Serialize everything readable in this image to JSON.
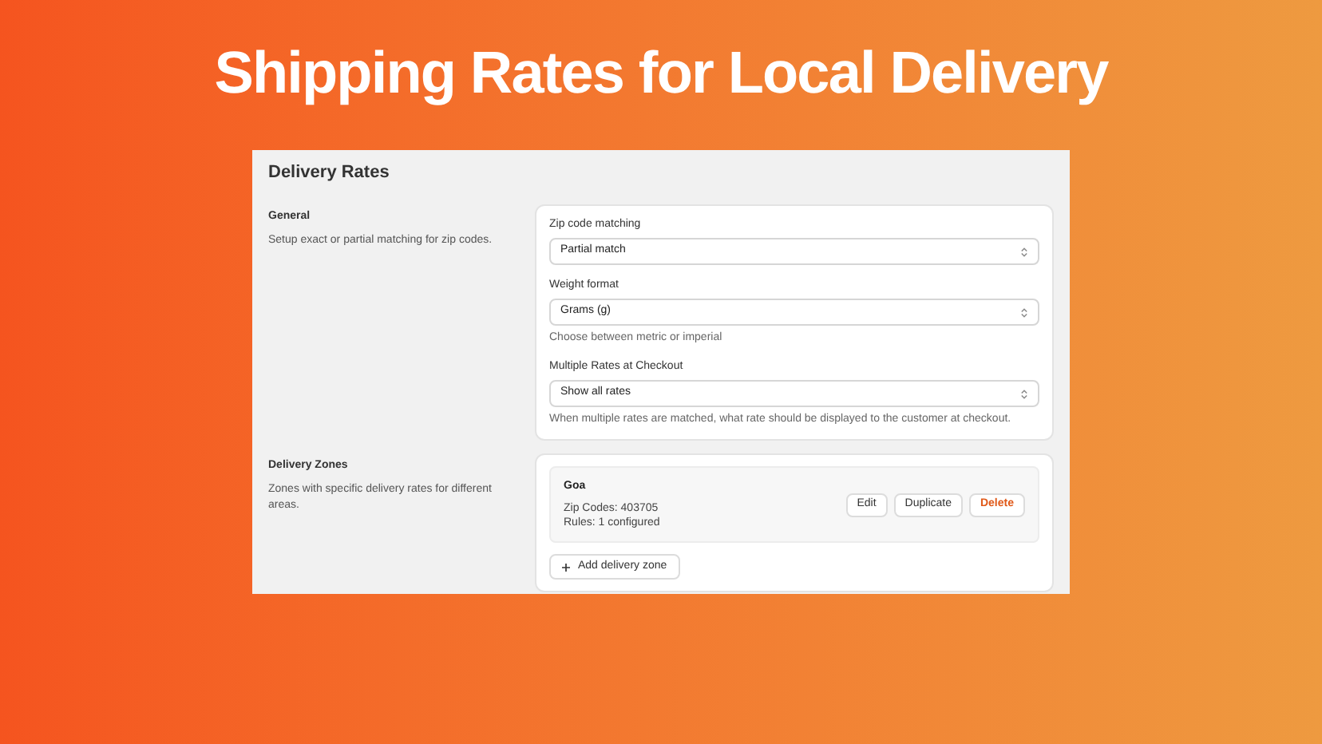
{
  "headline": "Shipping Rates for Local Delivery",
  "page_title": "Delivery Rates",
  "general": {
    "title": "General",
    "description": "Setup exact or partial matching for zip codes.",
    "fields": [
      {
        "label": "Zip code matching",
        "value": "Partial match"
      },
      {
        "label": "Weight format",
        "value": "Grams (g)",
        "help": "Choose between metric or imperial"
      },
      {
        "label": "Multiple Rates at Checkout",
        "value": "Show all rates",
        "help": "When multiple rates are matched, what rate should be displayed to the customer at checkout."
      }
    ]
  },
  "delivery_zones": {
    "title": "Delivery Zones",
    "description": "Zones with specific delivery rates for different areas.",
    "zones": [
      {
        "name": "Goa",
        "zip_codes": "Zip Codes: 403705",
        "rules": "Rules: 1 configured",
        "actions": [
          {
            "label": "Edit",
            "kind": "default"
          },
          {
            "label": "Duplicate",
            "kind": "default"
          },
          {
            "label": "Delete",
            "kind": "destructive"
          }
        ]
      }
    ],
    "add_button": "Add delivery zone"
  }
}
